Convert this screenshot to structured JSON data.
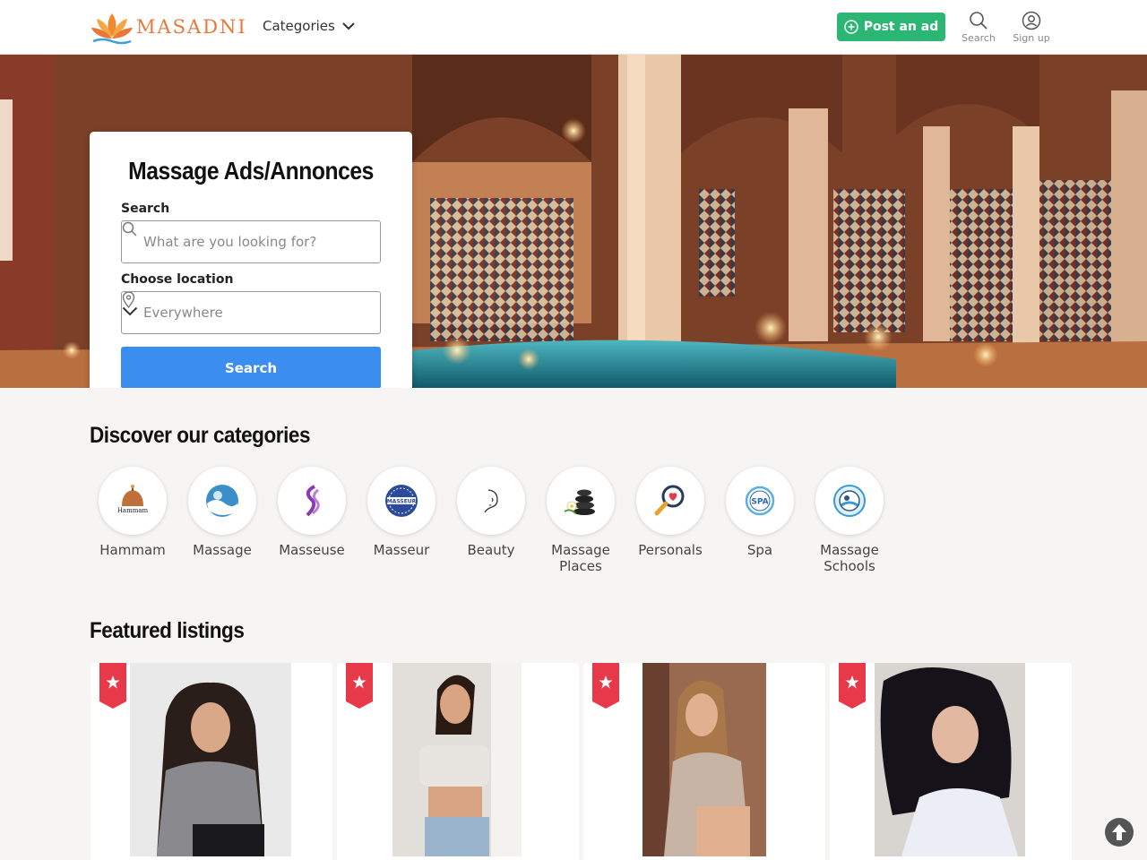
{
  "header": {
    "logo_text": "MASADNI",
    "categories_label": "Categories",
    "post_ad_label": "Post an ad",
    "search_label": "Search",
    "signup_label": "Sign up",
    "accent_color": "#2bb673"
  },
  "hero": {
    "title": "Massage Ads/Annonces",
    "search_label": "Search",
    "search_placeholder": "What are you looking for?",
    "location_label": "Choose location",
    "location_value": "Everywhere",
    "search_button": "Search",
    "button_color": "#3b8ef0"
  },
  "categories_section": {
    "title": "Discover our categories",
    "items": [
      {
        "label": "Hammam",
        "icon": "hammam-icon",
        "icon_text": "Hammam"
      },
      {
        "label": "Massage",
        "icon": "massage-icon"
      },
      {
        "label": "Masseuse",
        "icon": "masseuse-icon"
      },
      {
        "label": "Masseur",
        "icon": "masseur-icon",
        "icon_text": "MASSEUR"
      },
      {
        "label": "Beauty",
        "icon": "beauty-icon"
      },
      {
        "label": "Massage Places",
        "icon": "massage-places-icon"
      },
      {
        "label": "Personals",
        "icon": "personals-icon"
      },
      {
        "label": "Spa",
        "icon": "spa-icon",
        "icon_text": "SPA"
      },
      {
        "label": "Massage Schools",
        "icon": "massage-schools-icon"
      }
    ]
  },
  "featured_section": {
    "title": "Featured listings",
    "listings": [
      {
        "badge": "featured-star-icon"
      },
      {
        "badge": "featured-star-icon"
      },
      {
        "badge": "featured-star-icon"
      },
      {
        "badge": "featured-star-icon"
      }
    ],
    "badge_color": "#e8394a"
  }
}
